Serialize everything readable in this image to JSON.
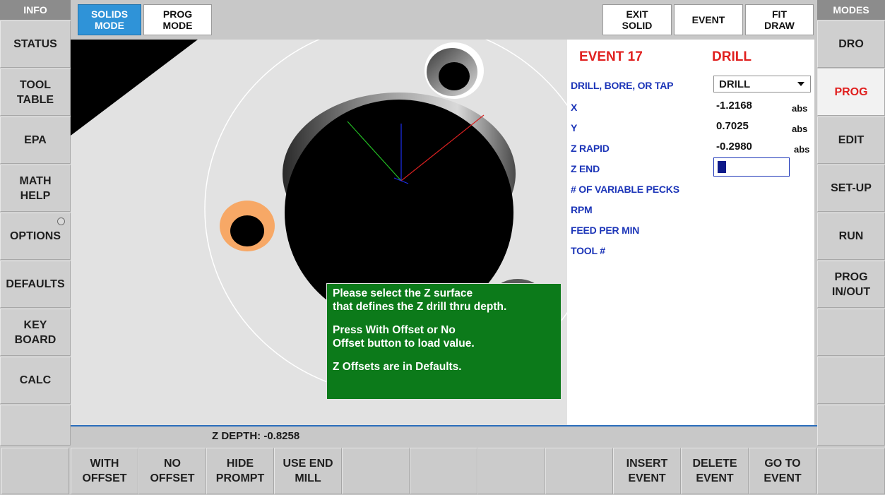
{
  "left_panel": {
    "header": "INFO",
    "items": [
      {
        "label": "STATUS"
      },
      {
        "label": "TOOL\nTABLE"
      },
      {
        "label": "EPA"
      },
      {
        "label": "MATH\nHELP"
      },
      {
        "label": "OPTIONS"
      },
      {
        "label": "DEFAULTS"
      },
      {
        "label": "KEY\nBOARD"
      },
      {
        "label": "CALC"
      },
      {
        "label": ""
      }
    ]
  },
  "right_panel": {
    "header": "MODES",
    "items": [
      {
        "label": "DRO"
      },
      {
        "label": "PROG",
        "active": true
      },
      {
        "label": "EDIT"
      },
      {
        "label": "SET-UP"
      },
      {
        "label": "RUN"
      },
      {
        "label": "PROG\nIN/OUT"
      },
      {
        "label": ""
      },
      {
        "label": ""
      },
      {
        "label": ""
      }
    ]
  },
  "topbar": {
    "solids_mode": "SOLIDS\nMODE",
    "prog_mode": "PROG\nMODE",
    "exit_solid": "EXIT\nSOLID",
    "event": "EVENT",
    "fit_draw": "FIT\nDRAW"
  },
  "form": {
    "event_title": "EVENT 17",
    "event_type": "DRILL",
    "fields": {
      "drill_bore_tap": {
        "label": "DRILL, BORE, OR TAP",
        "value": "DRILL"
      },
      "x": {
        "label": "X",
        "value": "-1.2168",
        "unit": "abs"
      },
      "y": {
        "label": "Y",
        "value": "0.7025",
        "unit": "abs"
      },
      "z_rapid": {
        "label": "Z RAPID",
        "value": "-0.2980",
        "unit": "abs"
      },
      "z_end": {
        "label": "Z END",
        "value": ""
      },
      "pecks": {
        "label": "# OF VARIABLE PECKS"
      },
      "rpm": {
        "label": "RPM"
      },
      "feed": {
        "label": "FEED PER MIN"
      },
      "tool": {
        "label": "TOOL #"
      }
    }
  },
  "prompt": {
    "line1": "Please select the Z surface\nthat defines the Z  drill thru depth.",
    "line2": "Press With Offset or No\nOffset button to load value.",
    "line3": "Z Offsets are in Defaults."
  },
  "depth_readout": "Z DEPTH: -0.8258",
  "bottom": {
    "buttons": [
      {
        "label": ""
      },
      {
        "label": "WITH\nOFFSET"
      },
      {
        "label": "NO\nOFFSET"
      },
      {
        "label": "HIDE\nPROMPT"
      },
      {
        "label": "USE END\nMILL"
      },
      {
        "label": ""
      },
      {
        "label": ""
      },
      {
        "label": ""
      },
      {
        "label": ""
      },
      {
        "label": "INSERT\nEVENT"
      },
      {
        "label": "DELETE\nEVENT"
      },
      {
        "label": "GO TO\nEVENT"
      },
      {
        "label": ""
      }
    ]
  },
  "colors": {
    "accent_blue": "#2f93d8",
    "active_red": "#e0201f",
    "label_blue": "#1c35b8",
    "prompt_green": "#0c7a1a",
    "selected_hole": "#f7a866"
  }
}
